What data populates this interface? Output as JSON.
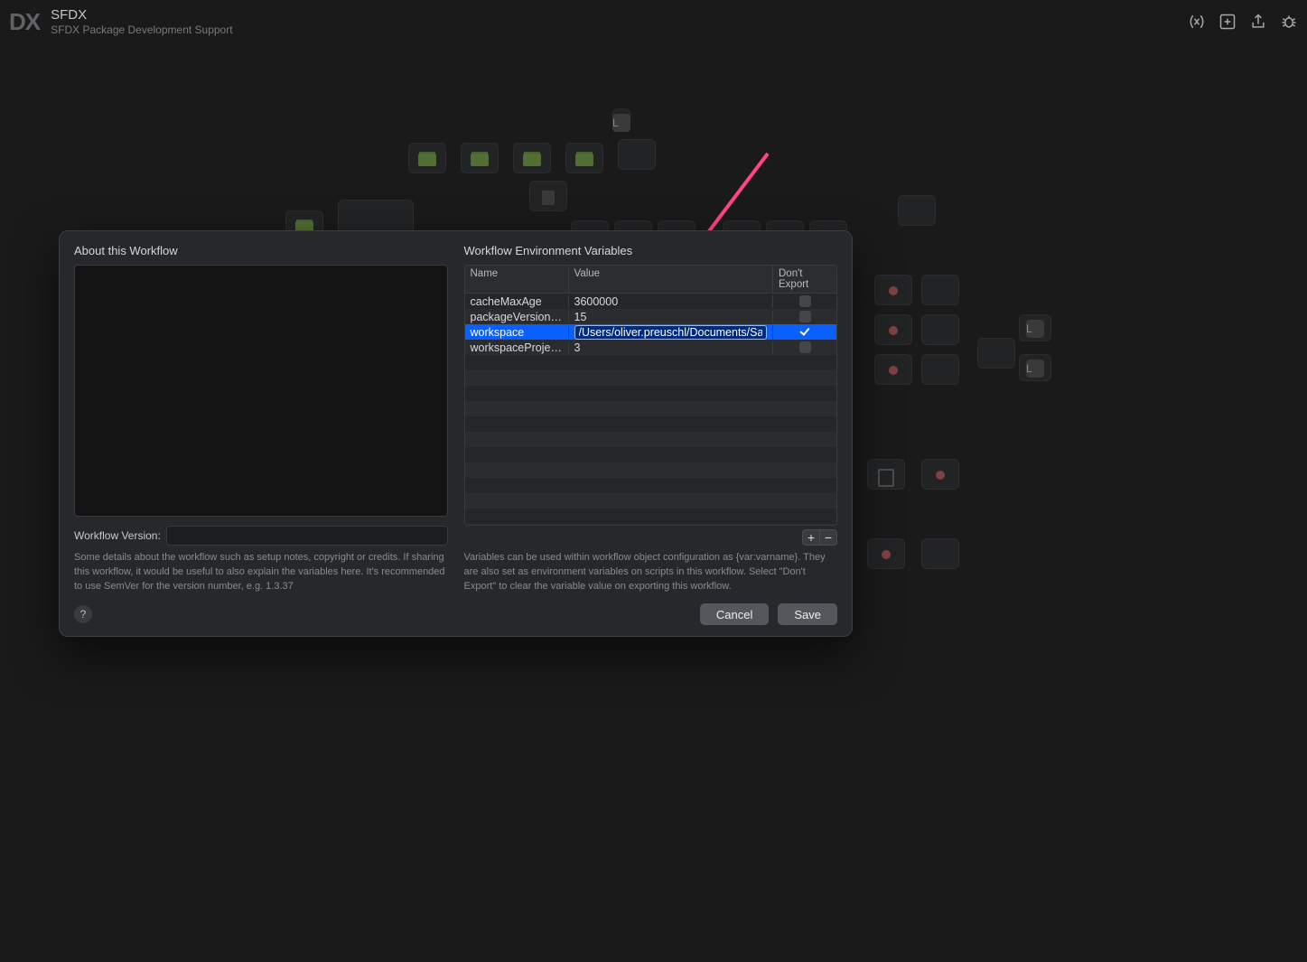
{
  "topbar": {
    "logo": "DX",
    "title": "SFDX",
    "subtitle": "SFDX Package Development Support"
  },
  "dialog": {
    "about_heading": "About this Workflow",
    "version_label": "Workflow Version:",
    "version_value": "",
    "about_hint": "Some details about the workflow such as setup notes, copyright or credits. If sharing this workflow, it would be useful to also explain the variables here. It's recommended to use SemVer for the version number, e.g. 1.3.37",
    "env_heading": "Workflow Environment Variables",
    "col_name": "Name",
    "col_value": "Value",
    "col_export": "Don't Export",
    "env_hint": "Variables can be used within workflow object configuration as {var:varname}. They are also set as environment variables on scripts in this workflow. Select \"Don't Export\" to clear the variable value on exporting this workflow.",
    "rows": [
      {
        "name": "cacheMaxAge",
        "value": "3600000",
        "dont_export": false
      },
      {
        "name": "packageVersionW…",
        "value": "15",
        "dont_export": false
      },
      {
        "name": "workspace",
        "value": "/Users/oliver.preuschl/Documents/Salesfo",
        "dont_export": true
      },
      {
        "name": "workspaceProject…",
        "value": "3",
        "dont_export": false
      }
    ],
    "selected_index": 2,
    "add_label": "+",
    "remove_label": "−",
    "help_label": "?",
    "cancel_label": "Cancel",
    "save_label": "Save"
  }
}
